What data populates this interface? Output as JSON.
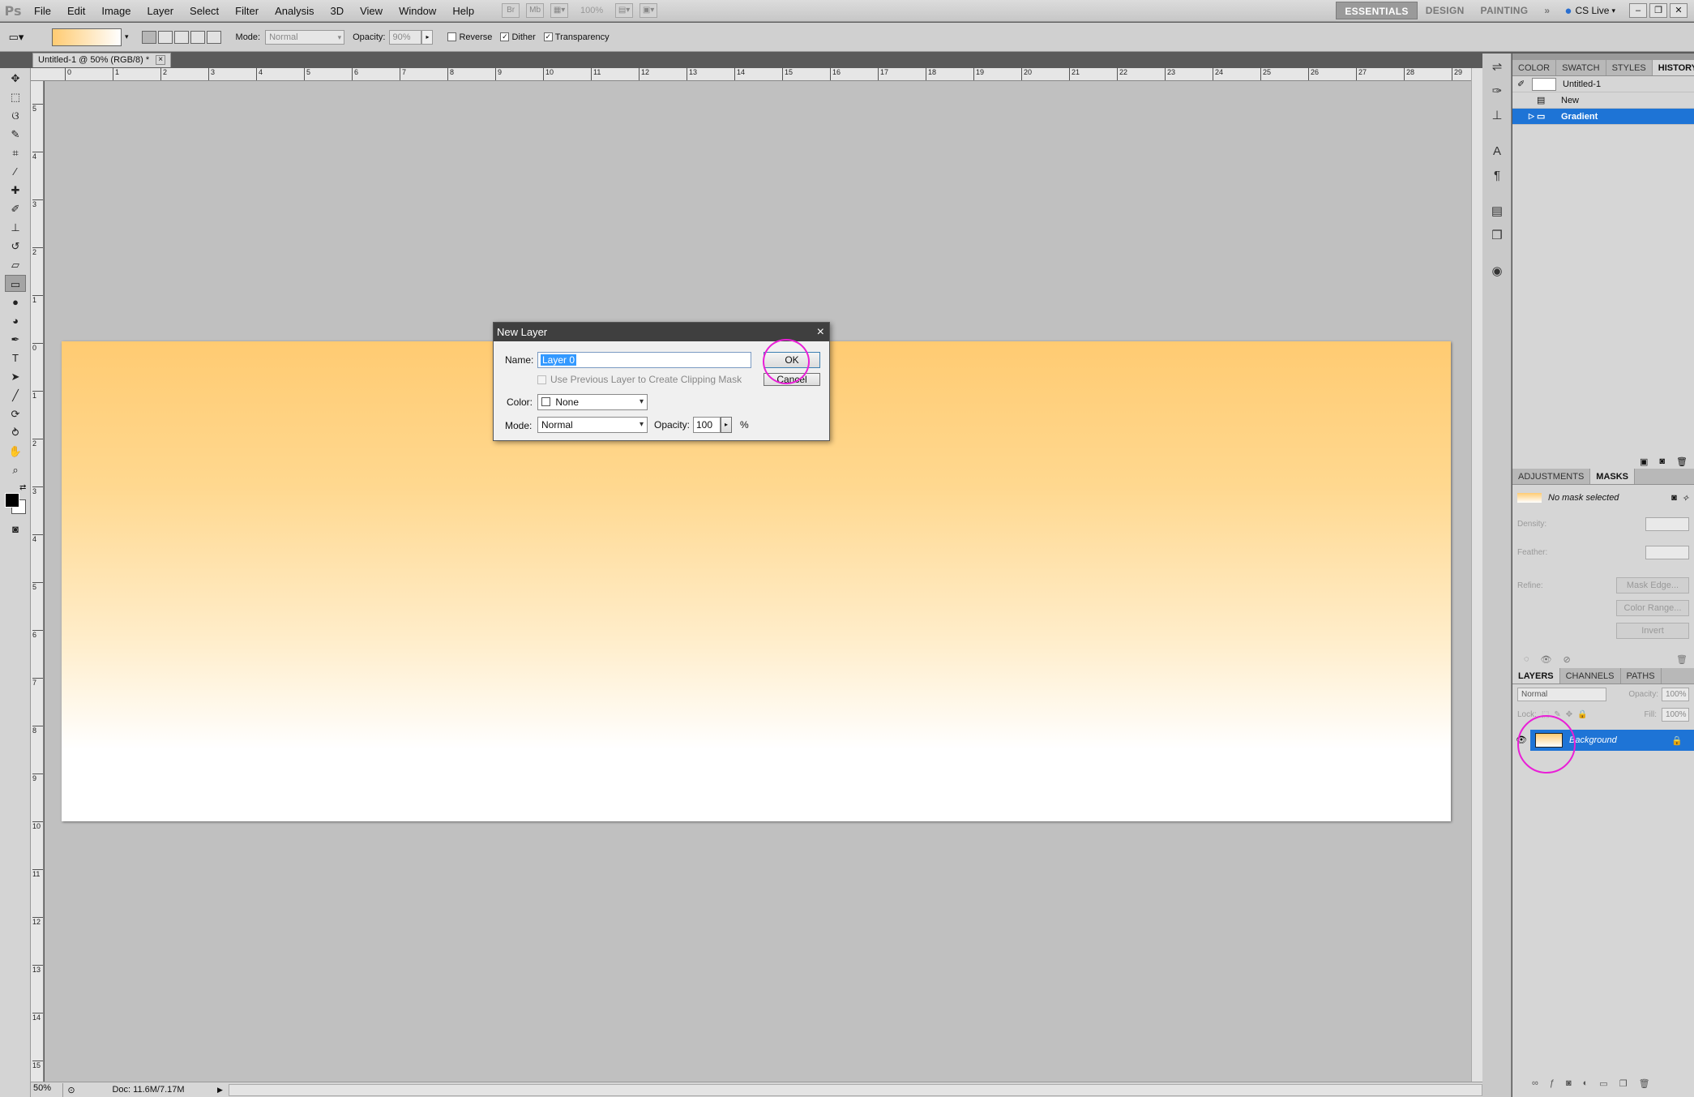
{
  "app": {
    "logo": "Ps"
  },
  "menubar": {
    "items": [
      "File",
      "Edit",
      "Image",
      "Layer",
      "Select",
      "Filter",
      "Analysis",
      "3D",
      "View",
      "Window",
      "Help"
    ],
    "zoom_value": "100%",
    "workspaces": [
      "ESSENTIALS",
      "DESIGN",
      "PAINTING"
    ],
    "more": "»",
    "cs_live": "CS Live"
  },
  "options": {
    "mode_label": "Mode:",
    "mode_value": "Normal",
    "opacity_label": "Opacity:",
    "opacity_value": "90%",
    "reverse_label": "Reverse",
    "dither_label": "Dither",
    "transparency_label": "Transparency"
  },
  "document": {
    "tab_title": "Untitled-1 @ 50% (RGB/8) *",
    "tab_close": "×",
    "zoom": "50%",
    "doc_info": "Doc: 11.6M/7.17M"
  },
  "ruler": {
    "h_ticks": [
      "0",
      "1",
      "2",
      "3",
      "4",
      "5",
      "6",
      "7",
      "8",
      "9",
      "10",
      "11",
      "12",
      "13",
      "14",
      "15",
      "16",
      "17",
      "18",
      "19",
      "20",
      "21",
      "22",
      "23",
      "24",
      "25",
      "26",
      "27",
      "28",
      "29"
    ],
    "v_ticks": [
      "5",
      "4",
      "3",
      "2",
      "1",
      "0",
      "1",
      "2",
      "3",
      "4",
      "5",
      "6",
      "7",
      "8",
      "9",
      "10",
      "11",
      "12",
      "13",
      "14",
      "15"
    ]
  },
  "panels": {
    "top_tabs": [
      "COLOR",
      "SWATCH",
      "STYLES",
      "HISTORY"
    ],
    "history": {
      "snapshot": "Untitled-1",
      "items": [
        "New",
        "Gradient"
      ]
    },
    "adjust_tabs": [
      "ADJUSTMENTS",
      "MASKS"
    ],
    "masks": {
      "no_mask": "No mask selected",
      "density": "Density:",
      "feather": "Feather:",
      "refine": "Refine:",
      "mask_edge": "Mask Edge...",
      "color_range": "Color Range...",
      "invert": "Invert"
    },
    "layer_tabs": [
      "LAYERS",
      "CHANNELS",
      "PATHS"
    ],
    "layers": {
      "blend_mode": "Normal",
      "opacity_label": "Opacity:",
      "opacity_value": "100%",
      "lock_label": "Lock:",
      "fill_label": "Fill:",
      "fill_value": "100%",
      "items": [
        {
          "name": "Background"
        }
      ]
    }
  },
  "dialog": {
    "title": "New Layer",
    "close": "×",
    "name_label": "Name:",
    "name_value": "Layer 0",
    "clipping_label": "Use Previous Layer to Create Clipping Mask",
    "color_label": "Color:",
    "color_value": "None",
    "mode_label": "Mode:",
    "mode_value": "Normal",
    "opacity_label": "Opacity:",
    "opacity_value": "100",
    "percent": "%",
    "ok": "OK",
    "cancel": "Cancel"
  },
  "colors": {
    "gradient_top": "#ffcb72",
    "gradient_bottom": "#ffffff",
    "selection": "#1e74d6",
    "highlight": "#e91fd7"
  }
}
